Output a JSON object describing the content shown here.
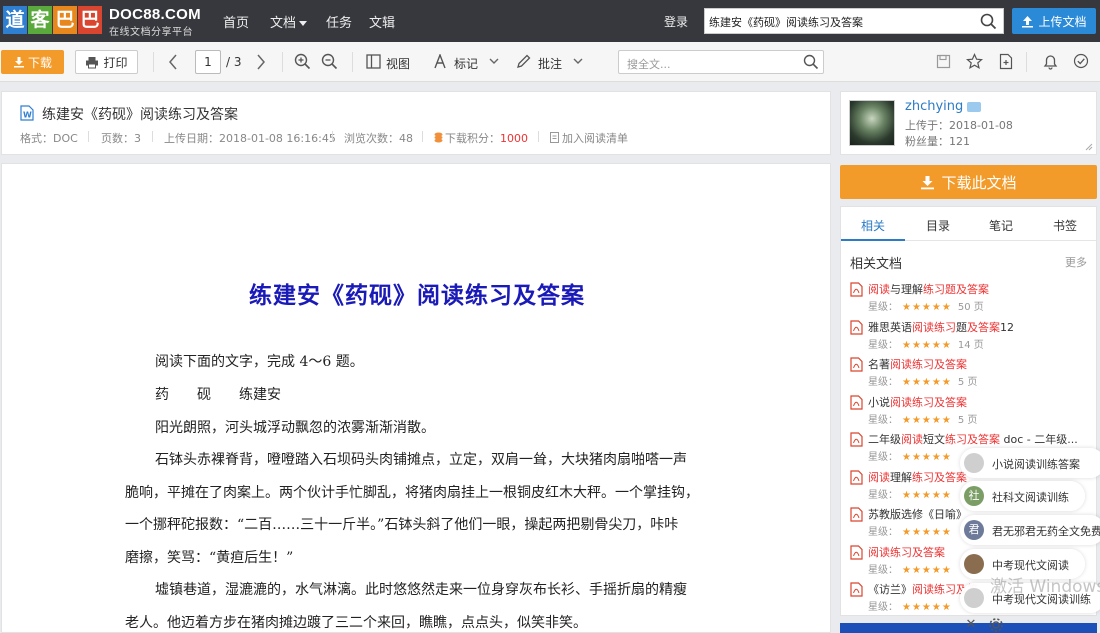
{
  "brand": {
    "logo_chars": [
      "道",
      "客",
      "巴",
      "巴"
    ],
    "name": "DOC88.COM",
    "subtitle": "在线文档分享平台",
    "colors": {
      "blue": "#2f7fd1",
      "green": "#5aa93c",
      "orange": "#e8871c",
      "red": "#d9452f"
    }
  },
  "nav": {
    "home": "首页",
    "docs": "文档",
    "tasks": "任务",
    "wenji": "文辑"
  },
  "header": {
    "login": "登录",
    "search_value": "练建安《药砚》阅读练习及答案",
    "upload": "上传文档"
  },
  "toolbar": {
    "download": "下载",
    "print": "打印",
    "page_current": "1",
    "page_total": "/ 3",
    "view": "视图",
    "mark": "标记",
    "annotate": "批注",
    "search_placeholder": "搜全文..."
  },
  "doc": {
    "title": "练建安《药砚》阅读练习及答案",
    "format": "格式：DOC",
    "pages": "页数：3",
    "upload_date": "上传日期：2018-01-08 16:16:45",
    "views": "浏览次数：48",
    "points_label": "下载积分：",
    "points_value": "1000",
    "add_to_list": "加入阅读清单"
  },
  "user": {
    "name": "zhchying",
    "uploaded": "上传于：2018-01-08",
    "fans": "粉丝量：121"
  },
  "download_big": "下载此文档",
  "sidebar": {
    "tabs": [
      "相关",
      "目录",
      "笔记",
      "书签"
    ],
    "active_tab": 0,
    "related_title": "相关文档",
    "more": "更多",
    "star_label": "星级：",
    "stars": "★★★★★",
    "items": [
      {
        "pre": "",
        "hl": "阅读",
        "mid": "与理解",
        "hl2": "练习题及答案",
        "post": "",
        "pages": "50 页"
      },
      {
        "pre": "雅思英语",
        "hl": "阅读练习",
        "mid": "题",
        "hl2": "及答案",
        "post": "12",
        "pages": "14 页"
      },
      {
        "pre": "名著",
        "hl": "阅读练习及答案",
        "mid": "",
        "hl2": "",
        "post": "",
        "pages": "5 页"
      },
      {
        "pre": "小说",
        "hl": "阅读练习及答案",
        "mid": "",
        "hl2": "",
        "post": "",
        "pages": "5 页"
      },
      {
        "pre": "二年级",
        "hl": "阅读",
        "mid": "短文",
        "hl2": "练习及答案",
        "post": " doc - 二年级...",
        "pages": ""
      },
      {
        "pre": "",
        "hl": "阅读",
        "mid": "理解",
        "hl2": "练习及答案",
        "post": "",
        "pages": ""
      },
      {
        "pre": "苏教版选修《日喻》",
        "hl": "",
        "mid": "",
        "hl2": "",
        "post": "",
        "pages": ""
      },
      {
        "pre": "",
        "hl": "阅读练习及答案",
        "mid": "",
        "hl2": "",
        "post": "",
        "pages": ""
      },
      {
        "pre": "《访兰》",
        "hl": "阅读练习及答",
        "mid": "",
        "hl2": "",
        "post": "",
        "pages": ""
      }
    ]
  },
  "content": {
    "title": "练建安《药砚》阅读练习及答案",
    "lines": [
      "阅读下面的文字，完成 4～6 题。",
      "药　　砚　　练建安",
      "阳光朗照，河头城浮动飘忽的浓雾渐渐消散。",
      "石钵头赤裸脊背，噔噔踏入石坝码头肉铺摊点，立定，双肩一耸，大块猪肉扇啪嗒一声",
      "脆响，平摊在了肉案上。两个伙计手忙脚乱，将猪肉扇挂上一根铜皮红木大秤。一个掌挂钩，",
      "一个挪秤砣报数：“二百……三十一斤半。”石钵头斜了他们一眼，操起两把剔骨尖刀，咔咔",
      "磨擦，笑骂：“黄疸后生！”",
      "墟镇巷道，湿漉漉的，水气淋漓。此时悠悠然走来一位身穿灰布长衫、手摇折扇的精瘦",
      "老人。他迈着方步在猪肉摊边踱了三二个来回，瞧瞧，点点头，似笑非笑。"
    ]
  },
  "popup": {
    "items": [
      {
        "label": "小说阅读训练答案",
        "icon_char": "",
        "color": "#cfcfcf"
      },
      {
        "label": "社科文阅读训练",
        "icon_char": "社",
        "color": "#7b9e66"
      },
      {
        "label": "君无邪君无药全文免费",
        "icon_char": "君",
        "color": "#6d7a99"
      },
      {
        "label": "中考现代文阅读",
        "icon_char": "",
        "color": "#8a6d4e"
      },
      {
        "label": "中考现代文阅读训练",
        "icon_char": "",
        "color": "#cfcfcf"
      }
    ],
    "close": "✕",
    "watermark": "激活 Windows"
  }
}
